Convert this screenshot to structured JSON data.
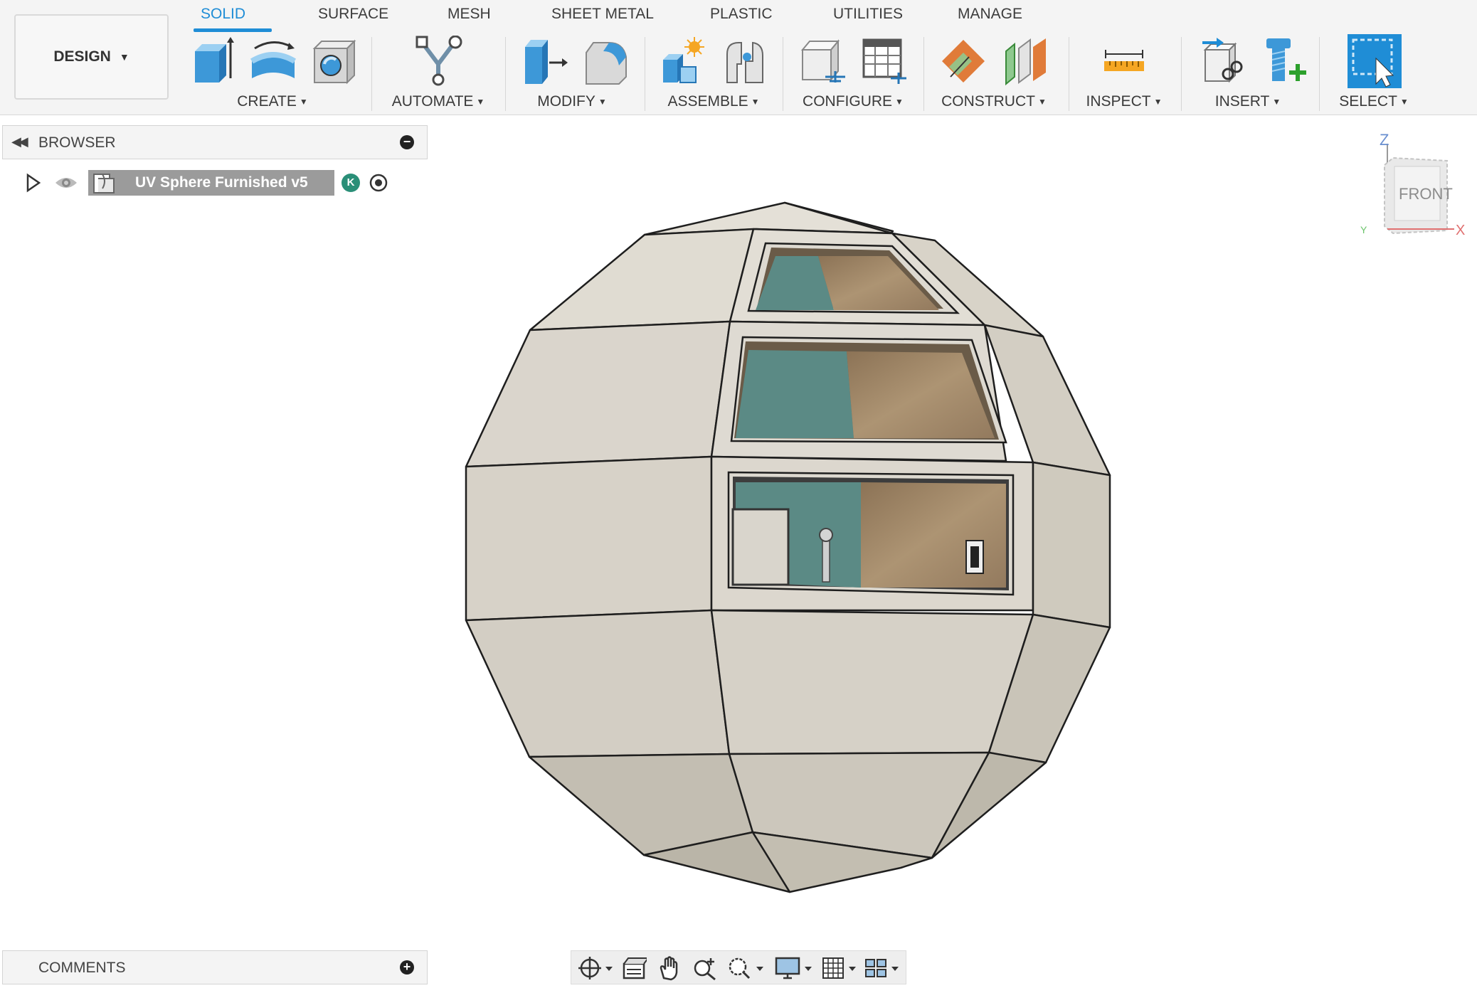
{
  "workspace": {
    "label": "DESIGN"
  },
  "tabs": [
    {
      "label": "SOLID",
      "active": true
    },
    {
      "label": "SURFACE"
    },
    {
      "label": "MESH"
    },
    {
      "label": "SHEET METAL"
    },
    {
      "label": "PLASTIC"
    },
    {
      "label": "UTILITIES"
    },
    {
      "label": "MANAGE"
    }
  ],
  "groups": [
    {
      "label": "CREATE"
    },
    {
      "label": "AUTOMATE"
    },
    {
      "label": "MODIFY"
    },
    {
      "label": "ASSEMBLE"
    },
    {
      "label": "CONFIGURE"
    },
    {
      "label": "CONSTRUCT"
    },
    {
      "label": "INSPECT"
    },
    {
      "label": "INSERT"
    },
    {
      "label": "SELECT"
    }
  ],
  "browser": {
    "title": "BROWSER",
    "document": {
      "name": "UV Sphere Furnished v5",
      "badge": "K"
    }
  },
  "comments": {
    "title": "COMMENTS"
  },
  "viewcube": {
    "face": "FRONT",
    "axis_z": "Z",
    "axis_x": "X",
    "axis_y": "Y"
  },
  "colors": {
    "accent": "#1f8dd6",
    "badge": "#2a8f78",
    "shell": "#dcd8cf",
    "wall": "#5b8a85",
    "floor": "#a38a6a"
  },
  "icons": [
    "extrude-icon",
    "revolve-icon",
    "hole-icon",
    "automate-icon",
    "press-pull-icon",
    "fillet-icon",
    "new-component-icon",
    "joint-icon",
    "parameters-icon",
    "table-icon",
    "offset-plane-icon",
    "midplane-icon",
    "measure-icon",
    "insert-derive-icon",
    "insert-mcmaster-icon",
    "select-icon"
  ]
}
